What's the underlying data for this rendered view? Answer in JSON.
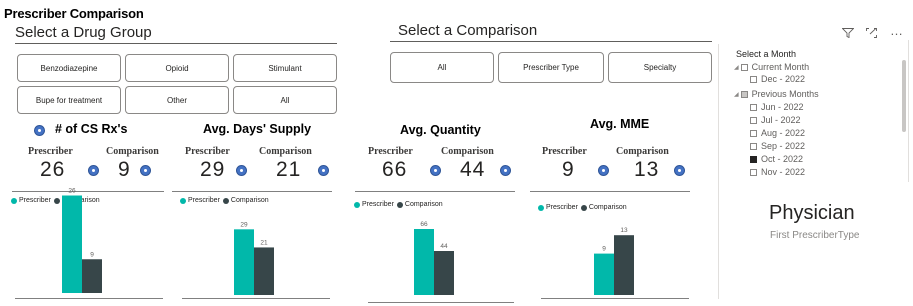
{
  "title": "Prescriber Comparison",
  "drug_group": {
    "heading": "Select a Drug Group",
    "options": [
      "Benzodiazepine",
      "Opioid",
      "Stimulant",
      "Bupe for treatment",
      "Other",
      "All"
    ]
  },
  "comparison": {
    "heading": "Select a Comparison",
    "options": [
      "All",
      "Prescriber Type",
      "Specialty"
    ]
  },
  "toolbar": {
    "icons": [
      "filter-icon",
      "focus-mode-icon",
      "more-options-icon"
    ],
    "more_label": "…"
  },
  "labels": {
    "prescriber": "Prescriber",
    "comparison": "Comparison"
  },
  "legend": {
    "prescriber": "Prescriber",
    "comparison": "Comparison"
  },
  "colors": {
    "prescriber": "#01b8aa",
    "comparison": "#374649",
    "info_icon": "#4472c4"
  },
  "cards": [
    {
      "title": "# of CS Rx's",
      "prescriber_value": "26",
      "comparison_value": "9"
    },
    {
      "title": "Avg. Days' Supply",
      "prescriber_value": "29",
      "comparison_value": "21"
    },
    {
      "title": "Avg. Quantity",
      "prescriber_value": "66",
      "comparison_value": "44"
    },
    {
      "title": "Avg. MME",
      "prescriber_value": "9",
      "comparison_value": "13"
    }
  ],
  "chart_data": [
    {
      "type": "bar",
      "categories": [
        ""
      ],
      "series": [
        {
          "name": "Prescriber",
          "values": [
            26
          ]
        },
        {
          "name": "Comparison",
          "values": [
            9
          ]
        }
      ],
      "legend": "top-left"
    },
    {
      "type": "bar",
      "categories": [
        ""
      ],
      "series": [
        {
          "name": "Prescriber",
          "values": [
            29
          ]
        },
        {
          "name": "Comparison",
          "values": [
            21
          ]
        }
      ],
      "legend": "top-left"
    },
    {
      "type": "bar",
      "categories": [
        ""
      ],
      "series": [
        {
          "name": "Prescriber",
          "values": [
            66
          ]
        },
        {
          "name": "Comparison",
          "values": [
            44
          ]
        }
      ],
      "legend": "top-left"
    },
    {
      "type": "bar",
      "categories": [
        ""
      ],
      "series": [
        {
          "name": "Prescriber",
          "values": [
            9
          ]
        },
        {
          "name": "Comparison",
          "values": [
            13
          ]
        }
      ],
      "legend": "top-left"
    }
  ],
  "month_slicer": {
    "title": "Select a Month",
    "groups": [
      {
        "label": "Current Month",
        "items": [
          {
            "label": "Dec - 2022",
            "checked": false
          }
        ]
      },
      {
        "label": "Previous Months",
        "items": [
          {
            "label": "Jun - 2022",
            "checked": false
          },
          {
            "label": "Jul - 2022",
            "checked": false
          },
          {
            "label": "Aug - 2022",
            "checked": false
          },
          {
            "label": "Sep - 2022",
            "checked": false
          },
          {
            "label": "Oct - 2022",
            "checked": true
          },
          {
            "label": "Nov - 2022",
            "checked": false
          }
        ]
      }
    ]
  },
  "prescriber_type_card": {
    "value": "Physician",
    "label": "First PrescriberType"
  }
}
